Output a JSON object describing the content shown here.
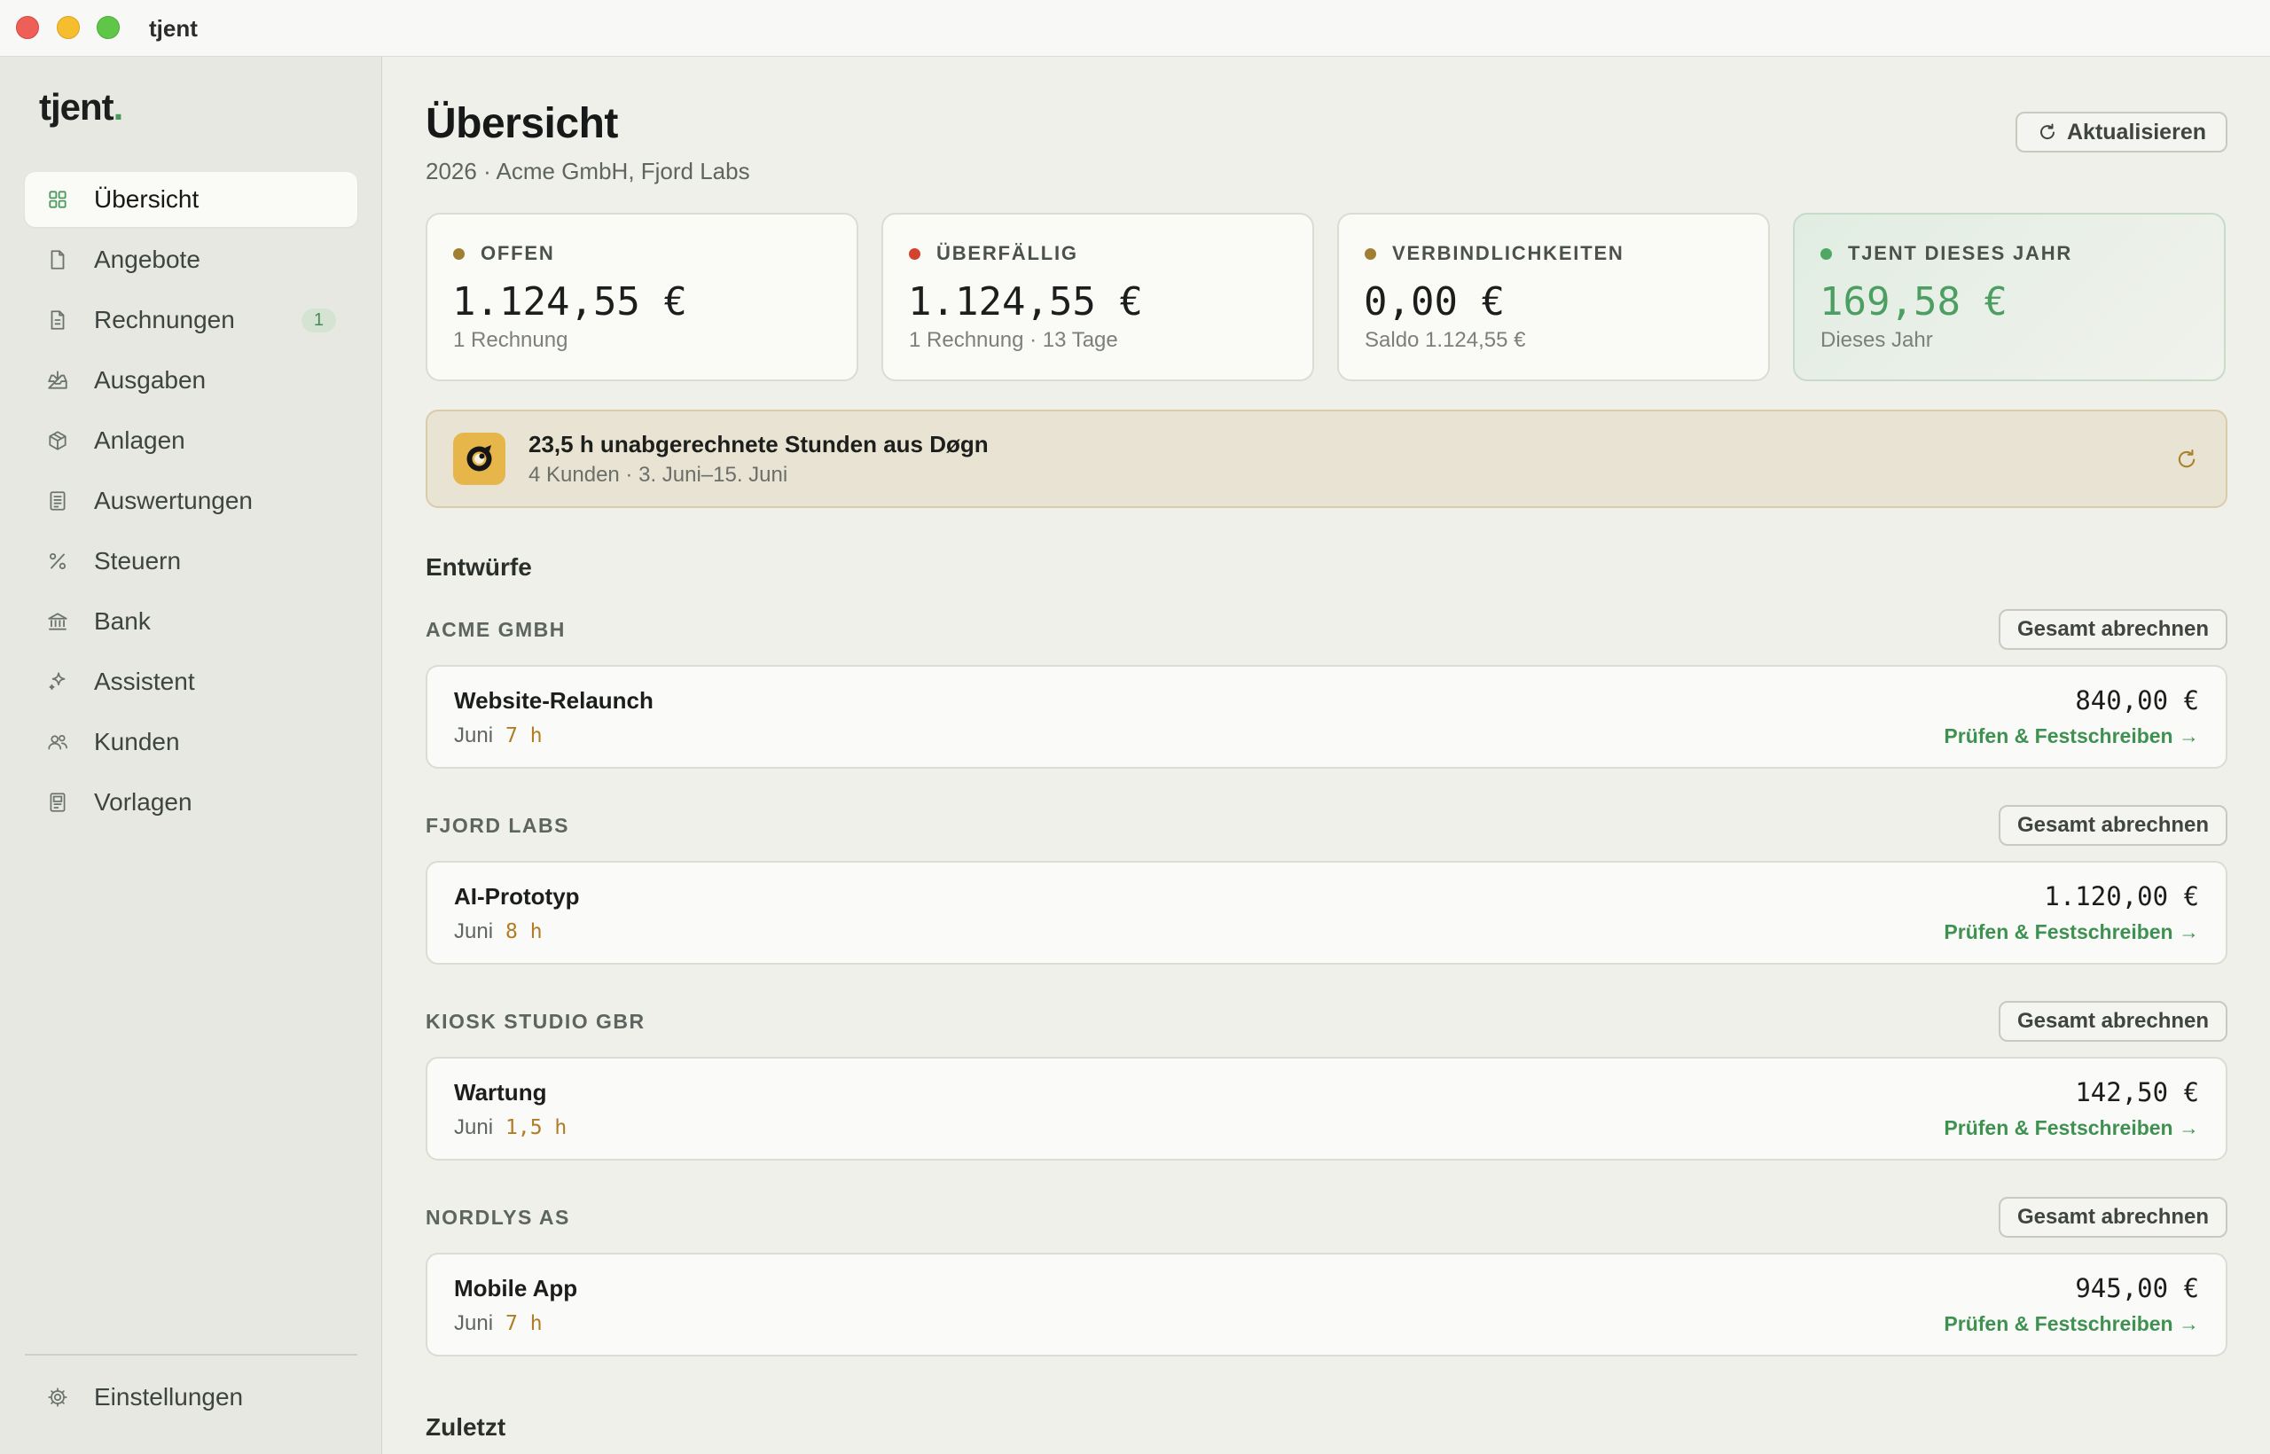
{
  "window": {
    "title": "tjent"
  },
  "sidebar": {
    "logo": "tjent",
    "logo_dot": ".",
    "items": [
      {
        "label": "Übersicht",
        "icon": "grid-icon",
        "active": true
      },
      {
        "label": "Angebote",
        "icon": "document-icon"
      },
      {
        "label": "Rechnungen",
        "icon": "invoice-icon",
        "badge": "1"
      },
      {
        "label": "Ausgaben",
        "icon": "inbox-tray-icon"
      },
      {
        "label": "Anlagen",
        "icon": "cube-icon"
      },
      {
        "label": "Auswertungen",
        "icon": "report-icon"
      },
      {
        "label": "Steuern",
        "icon": "percent-icon"
      },
      {
        "label": "Bank",
        "icon": "bank-icon"
      },
      {
        "label": "Assistent",
        "icon": "sparkle-icon"
      },
      {
        "label": "Kunden",
        "icon": "users-icon"
      },
      {
        "label": "Vorlagen",
        "icon": "template-icon"
      }
    ],
    "settings": {
      "label": "Einstellungen",
      "icon": "gear-icon"
    }
  },
  "header": {
    "title": "Übersicht",
    "subtitle": "2026 · Acme GmbH, Fjord Labs",
    "refresh_label": "Aktualisieren",
    "refresh_icon": "refresh-icon"
  },
  "stats": [
    {
      "label": "OFFEN",
      "value": "1.124,55 €",
      "sub": "1 Rechnung",
      "dot_color": "#a07f32"
    },
    {
      "label": "ÜBERFÄLLIG",
      "value": "1.124,55 €",
      "sub": "1 Rechnung · 13 Tage",
      "dot_color": "#d2432f"
    },
    {
      "label": "VERBINDLICHKEITEN",
      "value": "0,00 €",
      "sub": "Saldo 1.124,55 €",
      "dot_color": "#a07f32"
    },
    {
      "label": "TJENT DIESES JAHR",
      "value": "169,58 €",
      "sub": "Dieses Jahr",
      "dot_color": "#4fa764"
    }
  ],
  "banner": {
    "title": "23,5 h unabgerechnete Stunden aus Døgn",
    "subtitle": "4 Kunden · 3. Juni–15. Juni",
    "app_icon": "dogn-app-icon",
    "refresh_icon": "refresh-icon"
  },
  "drafts": {
    "heading": "Entwürfe",
    "groups": [
      {
        "client": "ACME GMBH",
        "button": "Gesamt abrechnen",
        "item": {
          "title": "Website-Relaunch",
          "month": "Juni",
          "hours": "7 h",
          "amount": "840,00 €",
          "action": "Prüfen & Festschreiben →"
        }
      },
      {
        "client": "FJORD LABS",
        "button": "Gesamt abrechnen",
        "item": {
          "title": "AI-Prototyp",
          "month": "Juni",
          "hours": "8 h",
          "amount": "1.120,00 €",
          "action": "Prüfen & Festschreiben →"
        }
      },
      {
        "client": "KIOSK STUDIO GBR",
        "button": "Gesamt abrechnen",
        "item": {
          "title": "Wartung",
          "month": "Juni",
          "hours": "1,5 h",
          "amount": "142,50 €",
          "action": "Prüfen & Festschreiben →"
        }
      },
      {
        "client": "NORDLYS AS",
        "button": "Gesamt abrechnen",
        "item": {
          "title": "Mobile App",
          "month": "Juni",
          "hours": "7 h",
          "amount": "945,00 €",
          "action": "Prüfen & Festschreiben →"
        }
      }
    ]
  },
  "recent": {
    "heading": "Zuletzt"
  },
  "colors": {
    "accent": "#4a9a5c",
    "background": "#f0f0ea",
    "sidebar": "#e8e8e2",
    "hours": "#b17c24",
    "link": "#3f9152"
  }
}
